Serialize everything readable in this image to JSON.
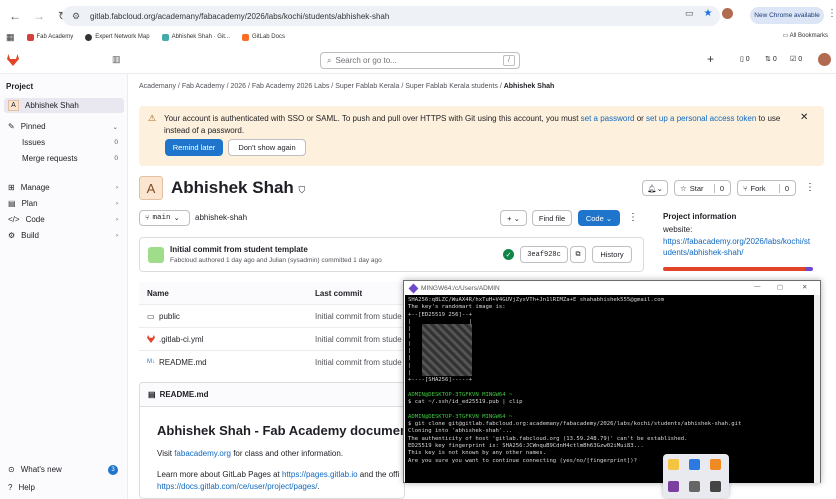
{
  "browser": {
    "url": "gitlab.fabcloud.org/academany/fabacademy/2026/labs/kochi/students/abhishek-shah",
    "new_chrome_label": "New Chrome available",
    "bookmarks": [
      "Fab Academy",
      "Expert Network Map",
      "Abhishek Shah · Git...",
      "GitLab Docs"
    ],
    "all_bookmarks": "All Bookmarks"
  },
  "header": {
    "search_placeholder": "Search or go to...",
    "search_key": "/",
    "issues_count": "0",
    "mr_count": "0",
    "todo_count": "0"
  },
  "sidebar": {
    "heading": "Project",
    "project_name": "Abhishek Shah",
    "pinned": "Pinned",
    "issues": "Issues",
    "issues_count": "0",
    "merge_requests": "Merge requests",
    "mr_count": "0",
    "manage": "Manage",
    "plan": "Plan",
    "code": "Code",
    "build": "Build",
    "whats_new": "What's new",
    "whats_new_count": "3",
    "help": "Help"
  },
  "breadcrumb": [
    "Academany",
    "Fab Academy",
    "2026",
    "Fab Academy 2026 Labs",
    "Super Fablab Kerala",
    "Super Fablab Kerala students",
    "Abhishek Shah"
  ],
  "alert": {
    "text_before": "Your account is authenticated with SSO or SAML. To push and pull over HTTPS with Git using this account, you must ",
    "link1": "set a password",
    "text_mid": " or ",
    "link2": "set up a personal access token",
    "text_after": " to use instead of a password.",
    "remind": "Remind later",
    "dismiss": "Don't show again"
  },
  "project": {
    "avatar_letter": "A",
    "title": "Abhishek Shah",
    "star": "Star",
    "star_count": "0",
    "fork": "Fork",
    "fork_count": "0",
    "branch": "main",
    "path": "abhishek-shah",
    "find_file": "Find file",
    "code_btn": "Code"
  },
  "commit": {
    "title": "Initial commit from student template",
    "meta": "Fabcloud authored 1 day ago and Julian (sysadmin) committed 1 day ago",
    "sha": "3eaf928c",
    "history": "History"
  },
  "files": {
    "col_name": "Name",
    "col_commit": "Last commit",
    "rows": [
      {
        "name": "public",
        "commit": "Initial commit from stude"
      },
      {
        "name": ".gitlab-ci.yml",
        "commit": "Initial commit from stude"
      },
      {
        "name": "README.md",
        "commit": "Initial commit from stude"
      }
    ]
  },
  "readme": {
    "file": "README.md",
    "heading": "Abhishek Shah - Fab Academy documenta",
    "line1_pre": "Visit ",
    "line1_link": "fabacademy.org",
    "line1_post": " for class and other information.",
    "line2_pre": "Learn more about GitLab Pages at ",
    "line2_link": "https://pages.gitlab.io",
    "line2_post": " and the offi",
    "line3_link": "https://docs.gitlab.com/ce/user/project/pages/",
    "line3_post": "."
  },
  "project_info": {
    "heading": "Project information",
    "website_label": "website:",
    "website_url": "https://fabacademy.org/2026/labs/kochi/students/abhishek-shah/"
  },
  "terminal": {
    "title": "MINGW64:/c/Users/ADMIN",
    "lines": [
      "SHA256:q8LZC/WuAX4R/hxTuH+V4GUVjZyxVTh+Jn1lRIMZa+E shahabhishek555@gmail.com",
      "The key's randomart image is:",
      "+--[ED25519 256]--+",
      "|                 |",
      "|                 |",
      "|                 |",
      "|                 |",
      "|                 |",
      "|                 |",
      "|                 |",
      "|        .+o.     |",
      "+----[SHA256]-----+",
      "",
      "ADMIN@DESKTOP-3TGFKVN MINGW64 ~",
      "$ cat ~/.ssh/id_ed25519.pub | clip",
      "",
      "ADMIN@DESKTOP-3TGFKVN MINGW64 ~",
      "$ git clone git@gitlab.fabcloud.org:academany/fabacademy/2026/labs/kochi/students/abhishek-shah.git",
      "Cloning into 'abhishek-shah'...",
      "The authenticity of host 'gitlab.fabcloud.org (13.59.248.79)' can't be established.",
      "ED25519 key fingerprint is: SHA256:JCWnquB9CdnH4ctlmBh63Gzw02iMui83...",
      "This key is not known by any other names.",
      "Are you sure you want to continue connecting (yes/no/[fingerprint])?"
    ]
  },
  "colors": {
    "accent": "#1f75cb",
    "alert_bg": "#fdf1dd",
    "brand": "#e24329"
  }
}
